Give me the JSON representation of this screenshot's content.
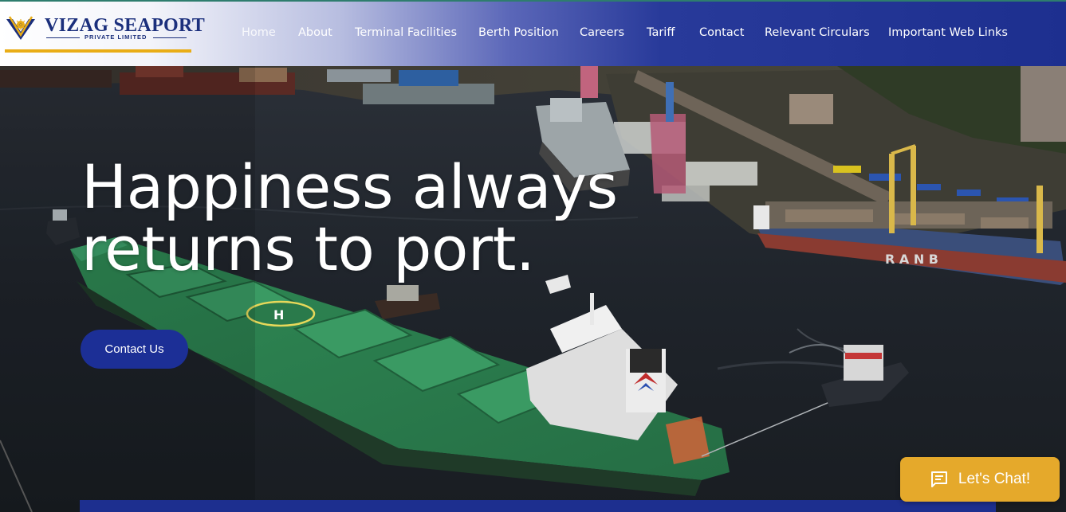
{
  "brand": {
    "name": "VIZAG SEAPORT",
    "sub": "PRIVATE LIMITED",
    "primary_color": "#1d2f8f",
    "accent_color": "#e9ad16"
  },
  "nav": {
    "items": [
      {
        "label": "Home",
        "active": true
      },
      {
        "label": "About"
      },
      {
        "label": "Terminal Facilities"
      },
      {
        "label": "Berth Position"
      },
      {
        "label": "Careers"
      },
      {
        "label": "Tariff"
      },
      {
        "label": "Contact"
      },
      {
        "label": "Relevant Circulars"
      },
      {
        "label": "Important Web Links"
      }
    ]
  },
  "hero": {
    "headline_line1": "Happiness always",
    "headline_line2": "returns to port.",
    "cta_label": "Contact Us",
    "cta_color": "#1c2f96",
    "ship_markings": "R A N B",
    "helipad_letter": "H"
  },
  "chat": {
    "label": "Let's Chat!",
    "icon": "chat-bubble-icon",
    "color": "#e5a92b"
  }
}
